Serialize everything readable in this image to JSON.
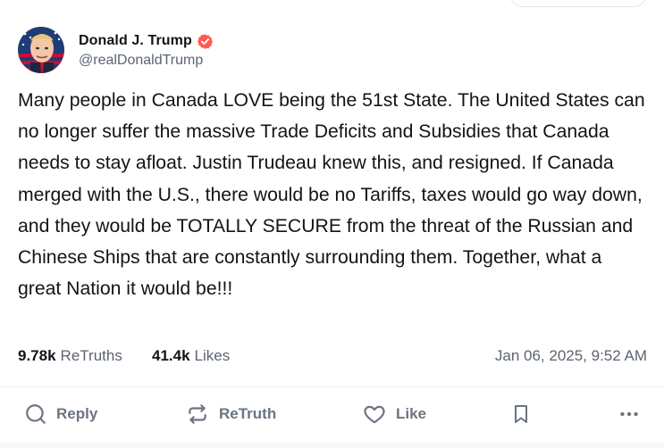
{
  "author": {
    "display_name": "Donald J. Trump",
    "handle": "@realDonaldTrump",
    "avatar_icon": "profile-avatar",
    "verified_icon": "verified-badge-icon",
    "verified_color": "#ff5a4f"
  },
  "post": {
    "text": "Many people in Canada LOVE being the 51st State. The United States can no longer suffer the massive Trade Deficits and Subsidies that Canada needs to stay afloat. Justin Trudeau knew this, and resigned. If Canada merged with the U.S., there would be no Tariffs, taxes would go way down, and they would be TOTALLY SECURE from the threat of the Russian and Chinese Ships that are constantly surrounding them. Together, what a great Nation it would be!!!",
    "retruths_count": "9.78k",
    "retruths_label": "ReTruths",
    "likes_count": "41.4k",
    "likes_label": "Likes",
    "timestamp": "Jan 06, 2025, 9:52 AM"
  },
  "actions": {
    "reply_label": "Reply",
    "retruth_label": "ReTruth",
    "like_label": "Like",
    "bookmark_icon": "bookmark-icon",
    "more_icon": "more-options-icon"
  },
  "colors": {
    "text": "#0f1419",
    "muted": "#5b6470",
    "action": "#6b7480"
  }
}
